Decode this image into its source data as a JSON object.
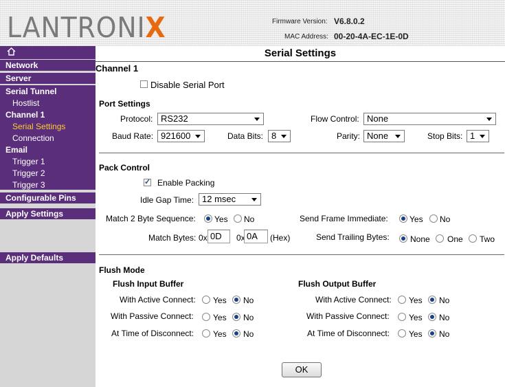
{
  "header": {
    "logo_text_main": "LANTRONI",
    "logo_text_x": "X",
    "firmware_label": "Firmware Version:",
    "firmware_value": "V6.8.0.2",
    "mac_label": "MAC Address:",
    "mac_value": "00-20-4A-EC-1E-0D"
  },
  "sidebar": {
    "home_icon": "home-icon",
    "network": "Network",
    "server": "Server",
    "serial_tunnel": "Serial Tunnel",
    "hostlist": "Hostlist",
    "channel1": "Channel 1",
    "serial_settings": "Serial Settings",
    "connection": "Connection",
    "email": "Email",
    "trigger1": "Trigger 1",
    "trigger2": "Trigger 2",
    "trigger3": "Trigger 3",
    "configurable_pins": "Configurable Pins",
    "apply_settings": "Apply Settings",
    "apply_defaults": "Apply Defaults"
  },
  "page": {
    "title": "Serial Settings",
    "channel": "Channel 1",
    "disable_serial_port": "Disable Serial Port"
  },
  "port_settings": {
    "heading": "Port Settings",
    "protocol_label": "Protocol:",
    "protocol_value": "RS232",
    "flow_control_label": "Flow Control:",
    "flow_control_value": "None",
    "baud_rate_label": "Baud Rate:",
    "baud_rate_value": "921600",
    "data_bits_label": "Data Bits:",
    "data_bits_value": "8",
    "parity_label": "Parity:",
    "parity_value": "None",
    "stop_bits_label": "Stop Bits:",
    "stop_bits_value": "1"
  },
  "pack_control": {
    "heading": "Pack Control",
    "enable_packing": "Enable Packing",
    "idle_gap_label": "Idle Gap Time:",
    "idle_gap_value": "12 msec",
    "match2_label": "Match 2 Byte Sequence:",
    "yes": "Yes",
    "no": "No",
    "send_frame_label": "Send Frame Immediate:",
    "match_bytes_label": "Match Bytes:",
    "hex_prefix": "0x",
    "match_byte1": "0D",
    "match_byte2": "0A",
    "hex_suffix": "(Hex)",
    "send_trailing_label": "Send Trailing Bytes:",
    "none": "None",
    "one": "One",
    "two": "Two"
  },
  "flush_mode": {
    "heading": "Flush Mode",
    "input_heading": "Flush Input Buffer",
    "output_heading": "Flush Output Buffer",
    "active_connect": "With Active Connect:",
    "passive_connect": "With Passive Connect:",
    "time_of_disconnect": "At Time of Disconnect:",
    "yes": "Yes",
    "no": "No"
  },
  "ok_label": "OK",
  "colors": {
    "sidebar_purple": "#5a2e7a",
    "active_item": "#ffcc33",
    "logo_x": "#e86a10"
  }
}
